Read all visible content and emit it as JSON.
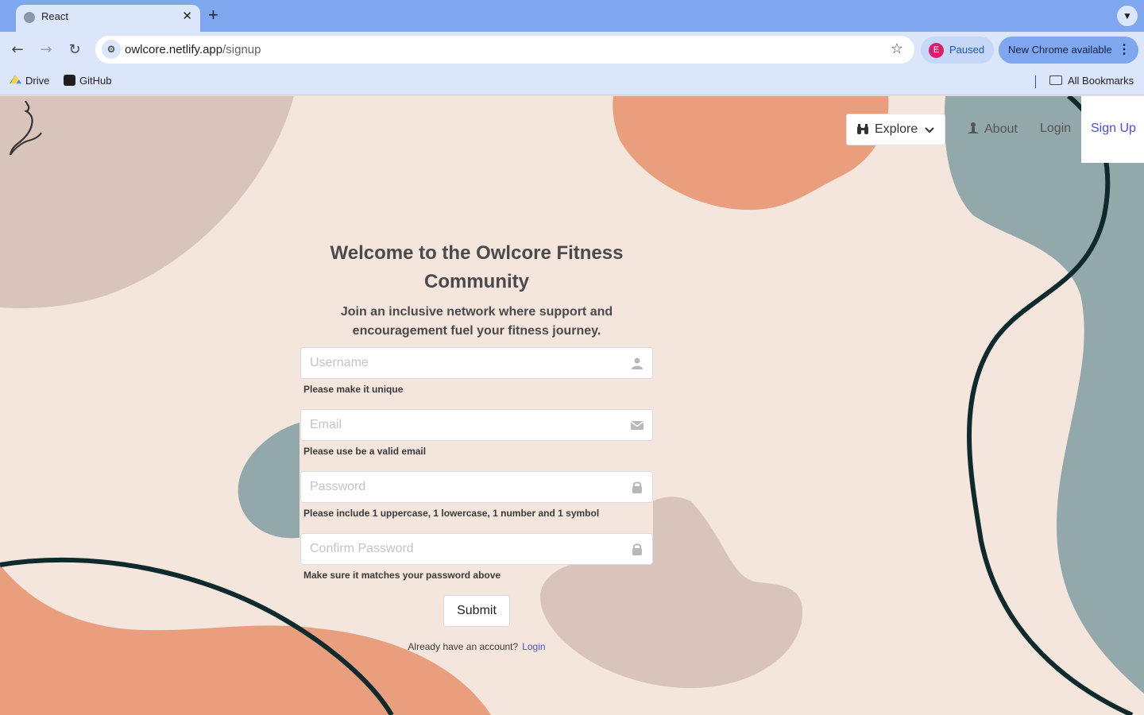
{
  "browser": {
    "tab_title": "React",
    "url_host": "owlcore.netlify.app",
    "url_path": "/signup",
    "profile_initial": "E",
    "profile_status": "Paused",
    "update_label": "New Chrome available",
    "bookmarks": [
      "Drive",
      "GitHub"
    ],
    "all_bookmarks_label": "All Bookmarks"
  },
  "nav": {
    "explore_label": "Explore",
    "about_label": "About",
    "login_label": "Login",
    "signup_label": "Sign Up"
  },
  "form": {
    "heading": "Welcome to the Owlcore Fitness Community",
    "subheading": "Join an inclusive network where support and encouragement fuel your fitness journey.",
    "username_placeholder": "Username",
    "username_help": "Please make it unique",
    "email_placeholder": "Email",
    "email_help": "Please use be a valid email",
    "password_placeholder": "Password",
    "password_help": "Please include 1 uppercase, 1 lowercase, 1 number and 1 symbol",
    "confirm_placeholder": "Confirm Password",
    "confirm_help": "Make sure it matches your password above",
    "submit_label": "Submit",
    "already_text": "Already have an account?",
    "login_link": "Login"
  },
  "colors": {
    "page_bg": "#f5e6dd",
    "blob_salmon": "#e99f7d",
    "blob_taupe": "#d9c4bc",
    "blob_slate": "#93a8ab",
    "curve_dark": "#0f2a2c",
    "accent_link": "#4c4ce0",
    "chrome_blue": "#7ea7f0"
  }
}
